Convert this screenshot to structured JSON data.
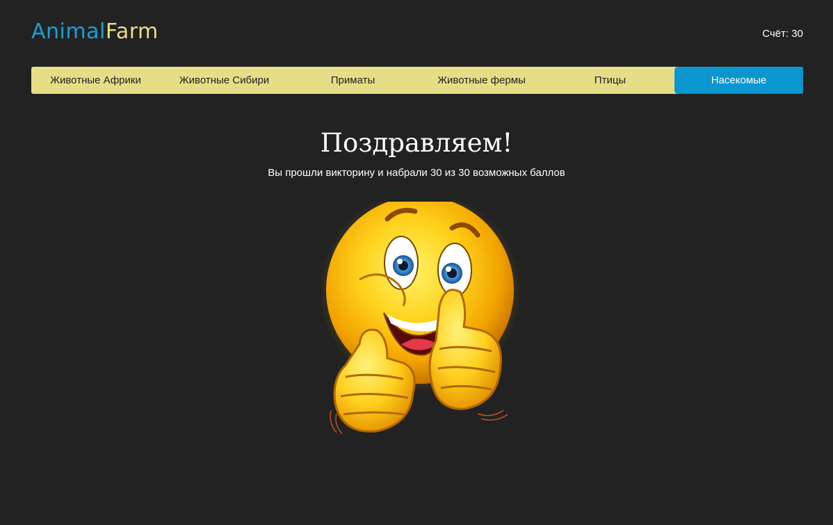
{
  "header": {
    "logo_part1": "Animal",
    "logo_part2": "Farm",
    "score": "Счёт: 30"
  },
  "nav": {
    "items": [
      {
        "label": "Животные Африки"
      },
      {
        "label": "Животные Сибири"
      },
      {
        "label": "Приматы"
      },
      {
        "label": "Животные фермы"
      },
      {
        "label": "Птицы"
      },
      {
        "label": "Насекомые",
        "active": true
      }
    ]
  },
  "result": {
    "title": "Поздравляем!",
    "message": "Вы прошли викторину и набрали 30 из 30 возможных баллов"
  },
  "colors": {
    "background": "#222222",
    "nav_bg": "#e6dd87",
    "nav_active": "#0a96cf",
    "logo_blue": "#1aa0d8",
    "logo_yellow": "#e8de88"
  },
  "icons": {
    "result_image": "smiley-thumbs-up-icon"
  }
}
